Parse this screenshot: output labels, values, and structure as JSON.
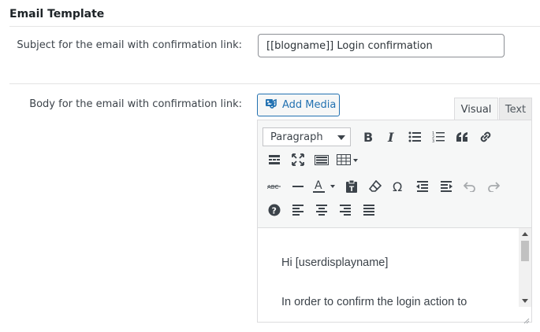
{
  "section": {
    "title": "Email Template"
  },
  "subject": {
    "label": "Subject for the email with confirmation link:",
    "value": "[[blogname]] Login confirmation"
  },
  "body": {
    "label": "Body for the email with confirmation link:",
    "add_media_label": "Add Media",
    "tabs": {
      "visual": "Visual",
      "text": "Text"
    },
    "format_select": "Paragraph",
    "content_lines": [
      "Hi [userdisplayname]",
      "In order to confirm the login action to"
    ]
  },
  "icons": {
    "row1": [
      "bold-icon",
      "italic-icon",
      "bullet-list-icon",
      "numbered-list-icon",
      "blockquote-icon",
      "link-icon"
    ],
    "row2": [
      "read-more-icon",
      "fullscreen-icon",
      "keyboard-toggle-icon",
      "table-icon"
    ],
    "row3": [
      "strikethrough-icon",
      "horizontal-line-icon",
      "text-color-icon",
      "paste-text-icon",
      "clear-formatting-icon",
      "special-character-icon",
      "outdent-icon",
      "indent-icon",
      "undo-icon",
      "redo-icon"
    ],
    "row4": [
      "help-icon",
      "align-left-icon",
      "align-center-icon",
      "align-right-icon",
      "justify-icon"
    ]
  },
  "colors": {
    "accent": "#2271b1",
    "toolbar_bg": "#f6f7f7",
    "border": "#dcdcde"
  }
}
